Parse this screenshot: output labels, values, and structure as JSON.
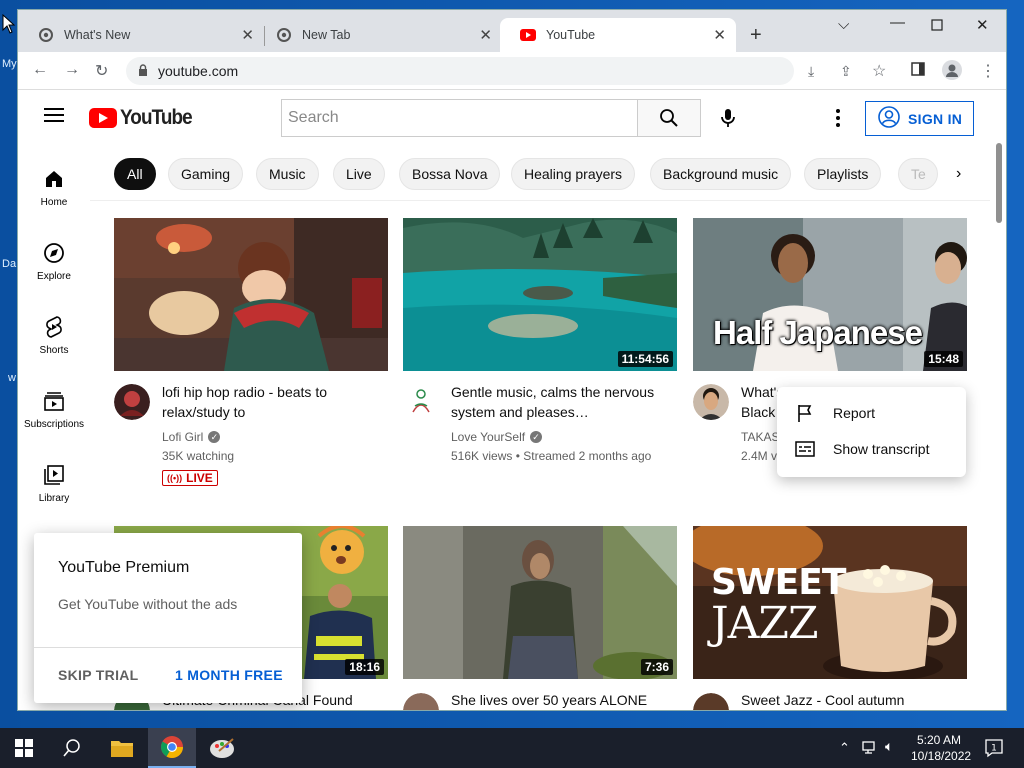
{
  "desktop": {
    "fragments": [
      "My",
      "Da",
      "w"
    ]
  },
  "tabs": [
    {
      "title": "What's New",
      "close": "✕"
    },
    {
      "title": "New Tab",
      "close": "✕"
    },
    {
      "title": "YouTube",
      "close": "✕"
    }
  ],
  "newtab": "+",
  "address": {
    "url": "youtube.com"
  },
  "youtube": {
    "logo_text": "YouTube",
    "search_placeholder": "Search",
    "signin_label": "SIGN IN",
    "guide": [
      {
        "label": "Home",
        "icon": "home-icon"
      },
      {
        "label": "Explore",
        "icon": "explore-icon"
      },
      {
        "label": "Shorts",
        "icon": "shorts-icon"
      },
      {
        "label": "Subscriptions",
        "icon": "subscriptions-icon"
      },
      {
        "label": "Library",
        "icon": "library-icon"
      }
    ],
    "chips": [
      "All",
      "Gaming",
      "Music",
      "Live",
      "Bossa Nova",
      "Healing prayers",
      "Background music",
      "Playlists",
      "Te"
    ],
    "videos": [
      {
        "title": "lofi hip hop radio - beats to relax/study to",
        "channel": "Lofi Girl",
        "meta": "35K watching",
        "badge": "LIVE",
        "duration": ""
      },
      {
        "title": "Gentle music, calms the nervous system and pleases…",
        "channel": "Love YourSelf",
        "meta": "516K views • Streamed 2 months ago",
        "duration": "11:54:56"
      },
      {
        "title": "What's …",
        "title2": "Black …",
        "channel": "TAKAS…",
        "meta": "2.4M v…",
        "duration": "15:48",
        "overlay": "Half Japanese"
      },
      {
        "title": "Ultimate Criminal Canal Found",
        "duration": "18:16"
      },
      {
        "title": "She lives over 50 years ALONE",
        "duration": "7:36"
      },
      {
        "title": "Sweet Jazz - Cool autumn",
        "duration": "",
        "overlay1": "SWEET",
        "overlay2": "JAZZ"
      }
    ],
    "context_menu": [
      {
        "label": "Report",
        "icon": "flag-icon"
      },
      {
        "label": "Show transcript",
        "icon": "transcript-icon"
      }
    ],
    "promo": {
      "title": "YouTube Premium",
      "desc": "Get YouTube without the ads",
      "skip": "SKIP TRIAL",
      "free": "1 MONTH FREE"
    }
  },
  "taskbar": {
    "time": "5:20 AM",
    "date": "10/18/2022",
    "notif_count": "1"
  },
  "colors": {
    "yt_red": "#ff0000",
    "link_blue": "#065fd4",
    "live_red": "#cc0000"
  }
}
